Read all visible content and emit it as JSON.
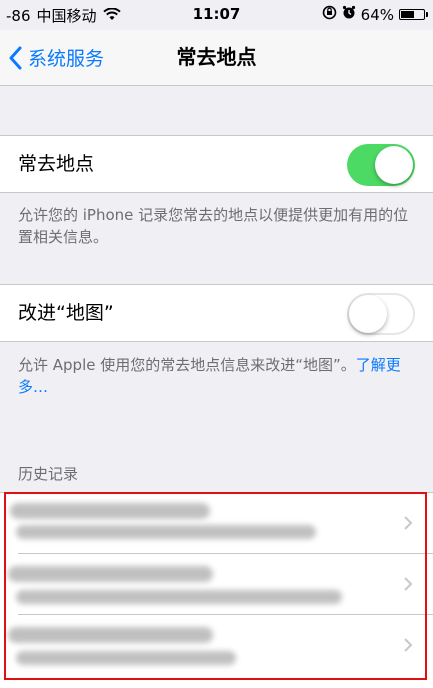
{
  "status_bar": {
    "signal": "-86",
    "carrier": "中国移动",
    "time": "11:07",
    "battery_text": "64%",
    "battery_level": 0.64
  },
  "nav": {
    "back_label": "系统服务",
    "title": "常去地点"
  },
  "frequent_locations": {
    "label": "常去地点",
    "enabled": true,
    "footer": "允许您的 iPhone 记录您常去的地点以便提供更加有用的位置相关信息。"
  },
  "improve_maps": {
    "label": "改进“地图”",
    "enabled": false,
    "footer_text": "允许 Apple 使用您的常去地点信息来改进“地图”。",
    "footer_link": "了解更多…"
  },
  "history": {
    "header": "历史记录"
  },
  "colors": {
    "accent": "#0a7aff",
    "toggle_on": "#4cd964",
    "highlight": "#e01010"
  }
}
